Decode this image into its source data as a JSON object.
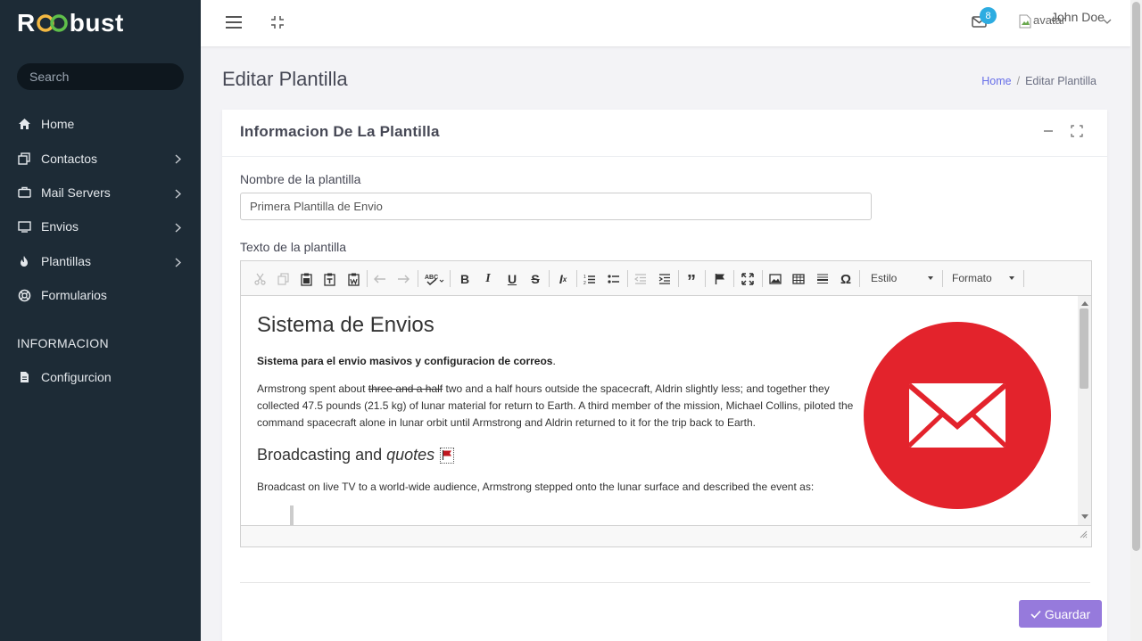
{
  "brand": {
    "prefix": "R",
    "suffix": "bust",
    "logo_colors": [
      "#f4b942",
      "#5fbf4a"
    ]
  },
  "search": {
    "placeholder": "Search"
  },
  "sidebar": {
    "items": [
      {
        "label": "Home",
        "icon": "home-icon",
        "has_submenu": false
      },
      {
        "label": "Contactos",
        "icon": "copy-icon",
        "has_submenu": true
      },
      {
        "label": "Mail Servers",
        "icon": "briefcase-icon",
        "has_submenu": true
      },
      {
        "label": "Envios",
        "icon": "monitor-icon",
        "has_submenu": true
      },
      {
        "label": "Plantillas",
        "icon": "fire-icon",
        "has_submenu": true
      },
      {
        "label": "Formularios",
        "icon": "lifebuoy-icon",
        "has_submenu": false
      }
    ],
    "section_label": "INFORMACION",
    "config_label": "Configurcion"
  },
  "topbar": {
    "notification_count": "8",
    "avatar_alt": "avatar",
    "username": "John Doe"
  },
  "page": {
    "title": "Editar Plantilla",
    "breadcrumb": {
      "home": "Home",
      "current": "Editar Plantilla"
    }
  },
  "card": {
    "title": "Informacion De La Plantilla",
    "name_label": "Nombre de la plantilla",
    "name_value": "Primera Plantilla de Envio",
    "text_label": "Texto de la plantilla",
    "save_label": "Guardar"
  },
  "editor": {
    "style_combo": "Estilo",
    "format_combo": "Formato",
    "content": {
      "heading": "Sistema de Envios",
      "bold_line": "Sistema para el envio masivos y configuracion de correos",
      "bold_suffix": ".",
      "para_lead": "Armstrong spent about ",
      "para_strike": "three and a half",
      "para_rest": " two and a half hours outside the spacecraft, Aldrin slightly less; and together they collected 47.5 pounds (21.5 kg) of lunar material for return to Earth. A third member of the mission, Michael Collins, piloted the command spacecraft alone in lunar orbit until Armstrong and Aldrin returned to it for the trip back to Earth.",
      "subheading": "Broadcasting and",
      "subheading_italic": "quotes",
      "para2": "Broadcast on live TV to a world-wide audience, Armstrong stepped onto the lunar surface and described the event as:"
    }
  },
  "colors": {
    "sidebar_bg": "#1d2b36",
    "accent": "#967adc",
    "link": "#666ee8",
    "badge": "#2dace1",
    "mail_image": "#e3232c"
  }
}
